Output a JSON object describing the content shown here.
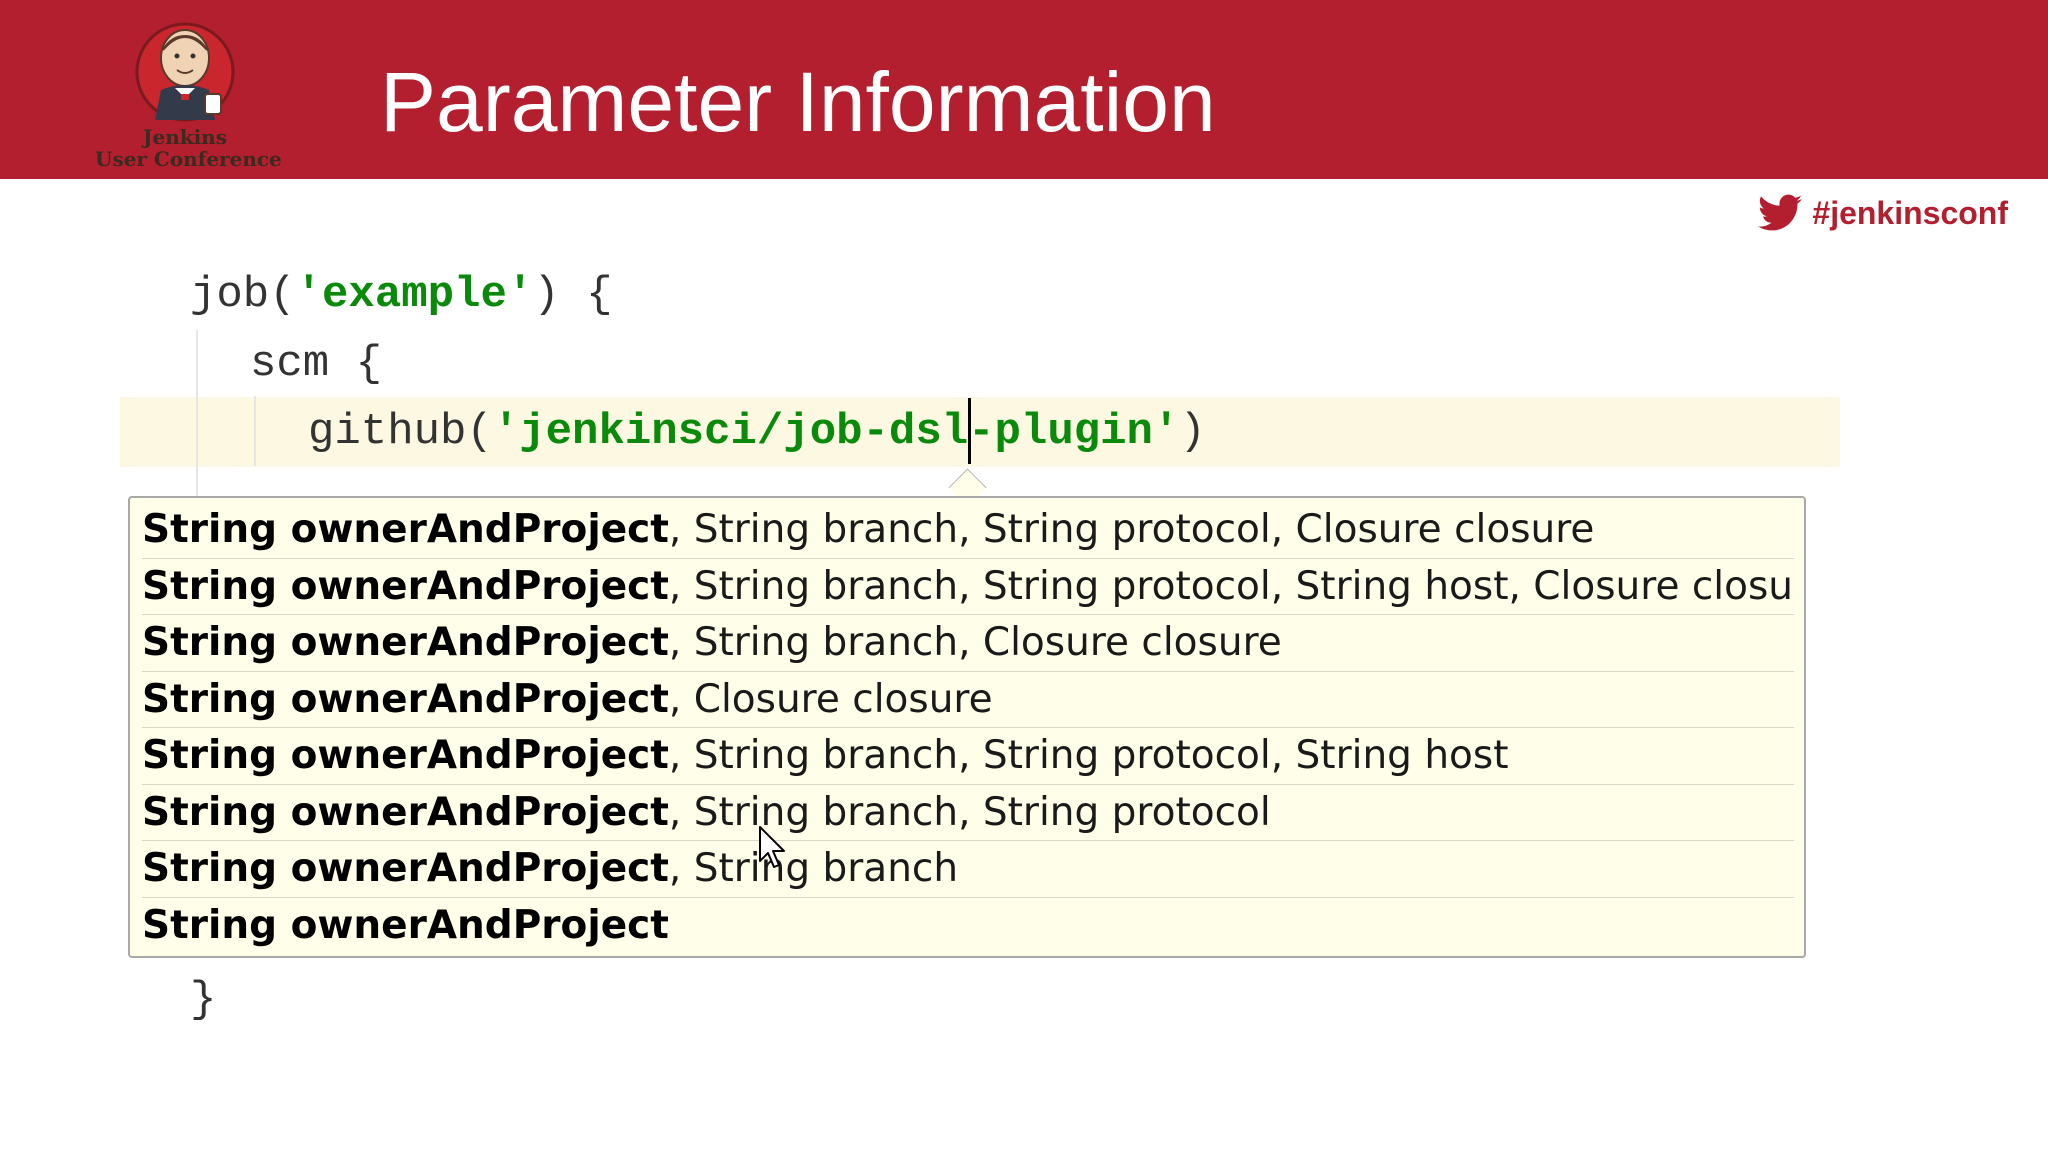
{
  "header": {
    "title": "Parameter Information",
    "logo_line1": "Jenkins",
    "logo_line2": "User Conference",
    "brand_color": "#b31f2e"
  },
  "social": {
    "hashtag": "#jenkinsconf",
    "icon": "twitter-bird-icon"
  },
  "code": {
    "line1_prefix": "job(",
    "line1_string": "'example'",
    "line1_suffix": ") {",
    "line2": "scm {",
    "line3_prefix": "github(",
    "line3_string": "'jenkinsci/job-dsl-plugin'",
    "line3_suffix": ")",
    "line_last": "}",
    "string_color": "#0a8a0a"
  },
  "popup": {
    "signatures": [
      {
        "bold": "String ownerAndProject",
        "rest": ", String branch, String protocol, Closure closure"
      },
      {
        "bold": "String ownerAndProject",
        "rest": ", String branch, String protocol, String host, Closure closure"
      },
      {
        "bold": "String ownerAndProject",
        "rest": ", String branch, Closure closure"
      },
      {
        "bold": "String ownerAndProject",
        "rest": ", Closure closure"
      },
      {
        "bold": "String ownerAndProject",
        "rest": ", String branch, String protocol, String host"
      },
      {
        "bold": "String ownerAndProject",
        "rest": ", String branch, String protocol"
      },
      {
        "bold": "String ownerAndProject",
        "rest": ", String branch"
      },
      {
        "bold": "String ownerAndProject",
        "rest": ""
      }
    ]
  }
}
